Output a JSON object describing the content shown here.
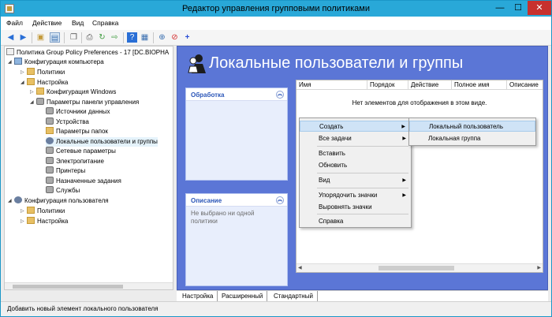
{
  "window": {
    "title": "Редактор управления групповыми политиками",
    "minimize": "—",
    "maximize": "☐",
    "close": "✕"
  },
  "menu": [
    "Файл",
    "Действие",
    "Вид",
    "Справка"
  ],
  "tree": {
    "items": [
      {
        "label": "Политика Group Policy Preferences - 17 [DC.BIOPHA",
        "twisty": "",
        "icon": "policy"
      },
      {
        "label": "Конфигурация компьютера",
        "twisty": "◢",
        "icon": "pc"
      },
      {
        "label": "Политики",
        "twisty": "▷",
        "icon": "folder"
      },
      {
        "label": "Настройка",
        "twisty": "◢",
        "icon": "folder"
      },
      {
        "label": "Конфигурация Windows",
        "twisty": "▷",
        "icon": "folder"
      },
      {
        "label": "Параметры панели управления",
        "twisty": "◢",
        "icon": "gear"
      },
      {
        "label": "Источники данных",
        "twisty": "",
        "icon": "gear"
      },
      {
        "label": "Устройства",
        "twisty": "",
        "icon": "gear"
      },
      {
        "label": "Параметры папок",
        "twisty": "",
        "icon": "folder"
      },
      {
        "label": "Локальные пользователи и группы",
        "twisty": "",
        "icon": "user",
        "selected": true
      },
      {
        "label": "Сетевые параметры",
        "twisty": "",
        "icon": "gear"
      },
      {
        "label": "Электропитание",
        "twisty": "",
        "icon": "gear"
      },
      {
        "label": "Принтеры",
        "twisty": "",
        "icon": "gear"
      },
      {
        "label": "Назначенные задания",
        "twisty": "",
        "icon": "gear"
      },
      {
        "label": "Службы",
        "twisty": "",
        "icon": "gear"
      },
      {
        "label": "Конфигурация пользователя",
        "twisty": "◢",
        "icon": "user"
      },
      {
        "label": "Политики",
        "twisty": "▷",
        "icon": "folder"
      },
      {
        "label": "Настройка",
        "twisty": "▷",
        "icon": "folder"
      }
    ]
  },
  "content": {
    "heading": "Локальные пользователи и группы",
    "processing_card": {
      "title": "Обработка"
    },
    "description_card": {
      "title": "Описание",
      "body": "Не выбрано ни одной политики"
    },
    "columns": [
      "Имя",
      "Порядок",
      "Действие",
      "Полное имя",
      "Описание"
    ],
    "empty_message": "Нет элементов для отображения в этом виде."
  },
  "context_menu": {
    "items": [
      {
        "label": "Создать",
        "submenu": true,
        "highlight": true
      },
      {
        "label": "Все задачи",
        "submenu": true
      },
      {
        "label": "Вставить"
      },
      {
        "label": "Обновить"
      },
      {
        "label": "Вид",
        "submenu": true
      },
      {
        "label": "Упорядочить значки",
        "submenu": true
      },
      {
        "label": "Выровнять значки"
      },
      {
        "label": "Справка"
      }
    ],
    "submenu": [
      "Локальный пользователь",
      "Локальная группа"
    ]
  },
  "tabs": [
    "Настройка",
    "Расширенный",
    "Стандартный"
  ],
  "status": "Добавить новый элемент локального пользователя"
}
